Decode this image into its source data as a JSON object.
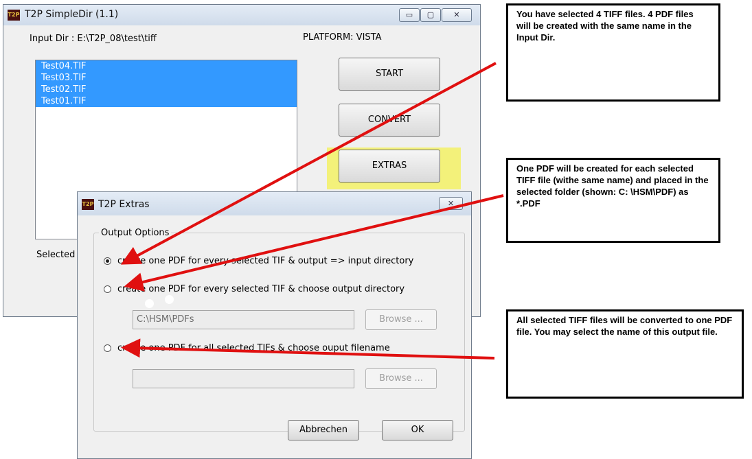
{
  "main_window": {
    "title": "T2P SimpleDir (1.1)",
    "icon_text": "T2P",
    "input_dir": "Input Dir :  E:\\T2P_08\\test\\tiff",
    "platform": "PLATFORM:  VISTA",
    "files": [
      "Test04.TIF",
      "Test03.TIF",
      "Test02.TIF",
      "Test01.TIF"
    ],
    "buttons": {
      "start": "START",
      "convert": "CONVERT",
      "extras": "EXTRAS"
    },
    "selected_label": "Selected",
    "ctrl_glyphs": {
      "minimize": "▭",
      "maximize": "▢",
      "close": "✕"
    }
  },
  "extras_dialog": {
    "title": "T2P Extras",
    "icon_text": "T2P",
    "close_glyph": "✕",
    "group_title": "Output Options",
    "options": [
      {
        "label": "create one PDF for every selected TIF & output => input directory",
        "checked": true
      },
      {
        "label": "create one PDF for every selected TIF & choose output directory",
        "checked": false
      },
      {
        "label": "create one PDF for all selected TIFs & choose ouput filename",
        "checked": false
      }
    ],
    "output_dir_value": "C:\\HSM\\PDFs",
    "output_file_value": "",
    "browse_label": "Browse ...",
    "cancel_label": "Abbrechen",
    "ok_label": "OK"
  },
  "callouts": {
    "c1": "You have selected 4 TIFF files. 4 PDF files will be created with the same name in the Input Dir.",
    "c2": "One PDF will be created for each selected TIFF file (withe same name) and placed in the selected folder (shown: C: \\HSM\\PDF) as *.PDF",
    "c3": "All selected TIFF files will be converted to one PDF file. You may select the name of this output file."
  },
  "colors": {
    "selection": "#3399ff",
    "highlight": "#f3f17a",
    "arrow": "#e01010"
  }
}
